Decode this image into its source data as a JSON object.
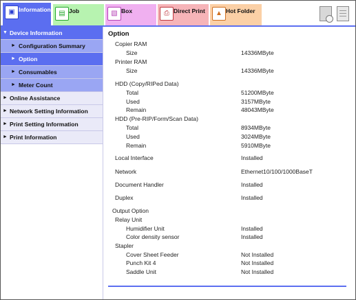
{
  "tabs": [
    {
      "label": "Information",
      "icon": "information-icon"
    },
    {
      "label": "Job",
      "icon": "job-icon"
    },
    {
      "label": "Box",
      "icon": "box-icon"
    },
    {
      "label": "Direct Print",
      "icon": "direct-print-icon"
    },
    {
      "label": "Hot Folder",
      "icon": "hot-folder-icon"
    }
  ],
  "sidebar": {
    "items": [
      {
        "label": "Device Information",
        "arrow": "▼"
      },
      {
        "label": "Configuration Summary",
        "arrow": "►"
      },
      {
        "label": "Option",
        "arrow": "►"
      },
      {
        "label": "Consumables",
        "arrow": "►"
      },
      {
        "label": "Meter Count",
        "arrow": "►"
      },
      {
        "label": "Online Assistance",
        "arrow": "►"
      },
      {
        "label": "Network Setting Information",
        "arrow": "►"
      },
      {
        "label": "Print Setting Information",
        "arrow": "►"
      },
      {
        "label": "Print Information",
        "arrow": "►"
      }
    ]
  },
  "main": {
    "title": "Option",
    "copier_ram": {
      "heading": "Copier RAM",
      "size_label": "Size",
      "size_value": "14336MByte"
    },
    "printer_ram": {
      "heading": "Printer RAM",
      "size_label": "Size",
      "size_value": "14336MByte"
    },
    "hdd_copy": {
      "heading": "HDD (Copy/RIPed Data)",
      "total_label": "Total",
      "total_value": "51200MByte",
      "used_label": "Used",
      "used_value": "3157MByte",
      "remain_label": "Remain",
      "remain_value": "48043MByte"
    },
    "hdd_prerip": {
      "heading": "HDD (Pre-RIP/Form/Scan Data)",
      "total_label": "Total",
      "total_value": "8934MByte",
      "used_label": "Used",
      "used_value": "3024MByte",
      "remain_label": "Remain",
      "remain_value": "5910MByte"
    },
    "local_interface": {
      "label": "Local Interface",
      "value": "Installed"
    },
    "network": {
      "label": "Network",
      "value": "Ethernet10/100/1000BaseT"
    },
    "document_handler": {
      "label": "Document Handler",
      "value": "Installed"
    },
    "duplex": {
      "label": "Duplex",
      "value": "Installed"
    },
    "output_option": {
      "heading": "Output Option",
      "relay_unit": "Relay Unit",
      "humidifier_label": "Humidifier Unit",
      "humidifier_value": "Installed",
      "color_density_label": "Color density sensor",
      "color_density_value": "Installed",
      "stapler": "Stapler",
      "cover_sheet_label": "Cover Sheet Feeder",
      "cover_sheet_value": "Not Installed",
      "punch_kit_label": "Punch Kit 4",
      "punch_kit_value": "Not Installed",
      "saddle_unit_label": "Saddle Unit",
      "saddle_unit_value": "Not Installed"
    }
  },
  "colors": {
    "accent": "#5b6ef0",
    "sub_item": "#9aa6f3",
    "sidebar_bg": "#eaeaf8",
    "tab_job": "#b7f3b0",
    "tab_box": "#f0b0f0",
    "tab_direct_print": "#f6b4b8",
    "tab_hot_folder": "#fbd0a6"
  },
  "toolbar_icons": [
    "device-status-icon",
    "panel-display-icon"
  ]
}
